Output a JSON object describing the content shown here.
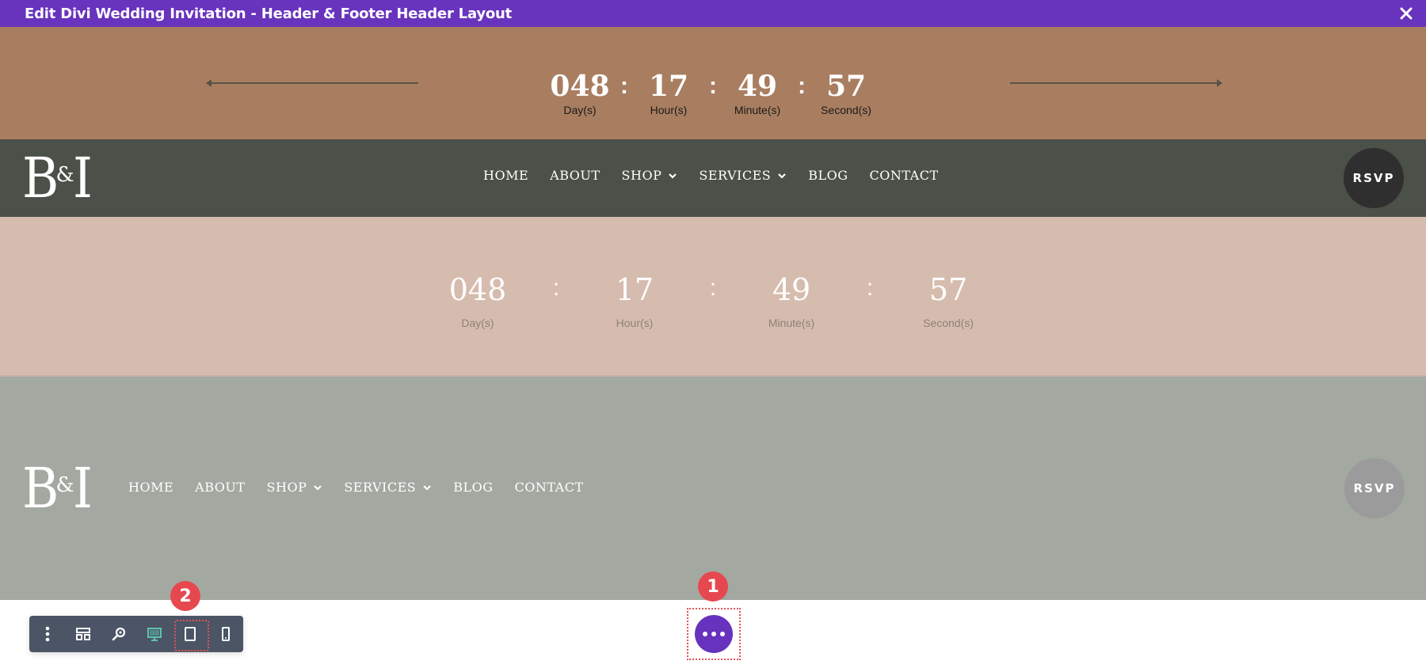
{
  "window": {
    "title": "Edit Divi Wedding Invitation - Header & Footer Header Layout",
    "close_icon": "close-icon"
  },
  "countdown_top": {
    "units": [
      {
        "value": "048",
        "label": "Day(s)"
      },
      {
        "value": "17",
        "label": "Hour(s)"
      },
      {
        "value": "49",
        "label": "Minute(s)"
      },
      {
        "value": "57",
        "label": "Second(s)"
      }
    ],
    "separator": ":"
  },
  "header_dark": {
    "logo": {
      "left": "B",
      "amp": "&",
      "right": "I"
    },
    "nav": [
      {
        "label": "HOME",
        "dropdown": false
      },
      {
        "label": "ABOUT",
        "dropdown": false
      },
      {
        "label": "SHOP",
        "dropdown": true
      },
      {
        "label": "SERVICES",
        "dropdown": true
      },
      {
        "label": "BLOG",
        "dropdown": false
      },
      {
        "label": "CONTACT",
        "dropdown": false
      }
    ],
    "rsvp_label": "RSVP"
  },
  "countdown_bottom": {
    "units": [
      {
        "value": "048",
        "label": "Day(s)"
      },
      {
        "value": "17",
        "label": "Hour(s)"
      },
      {
        "value": "49",
        "label": "Minute(s)"
      },
      {
        "value": "57",
        "label": "Second(s)"
      }
    ],
    "separator": ":"
  },
  "header_grey": {
    "logo": {
      "left": "B",
      "amp": "&",
      "right": "I"
    },
    "nav": [
      {
        "label": "HOME",
        "dropdown": false
      },
      {
        "label": "ABOUT",
        "dropdown": false
      },
      {
        "label": "SHOP",
        "dropdown": true
      },
      {
        "label": "SERVICES",
        "dropdown": true
      },
      {
        "label": "BLOG",
        "dropdown": false
      },
      {
        "label": "CONTACT",
        "dropdown": false
      }
    ],
    "rsvp_label": "RSVP"
  },
  "builder_toolbar": {
    "buttons": [
      {
        "name": "more-options",
        "icon": "vertical-dots-icon"
      },
      {
        "name": "wireframe-view",
        "icon": "layout-icon"
      },
      {
        "name": "zoom",
        "icon": "magnify-icon"
      },
      {
        "name": "desktop-view",
        "icon": "desktop-icon",
        "active": true
      },
      {
        "name": "tablet-view",
        "icon": "tablet-icon",
        "highlighted": true
      },
      {
        "name": "phone-view",
        "icon": "phone-icon"
      }
    ]
  },
  "annotations": {
    "step1": "1",
    "step2": "2"
  },
  "colors": {
    "titlebar": "#6833bd",
    "countdown_top_bg": "#a97e60",
    "header_dark_bg": "#4b5048",
    "countdown_bottom_bg": "#d6bcae",
    "header_grey_bg": "#a3a8a1",
    "toolbar_bg": "#4b5565",
    "accent_purple": "#6732be",
    "annotation_red": "#e6484f",
    "active_view_teal": "#5ec2b0"
  }
}
